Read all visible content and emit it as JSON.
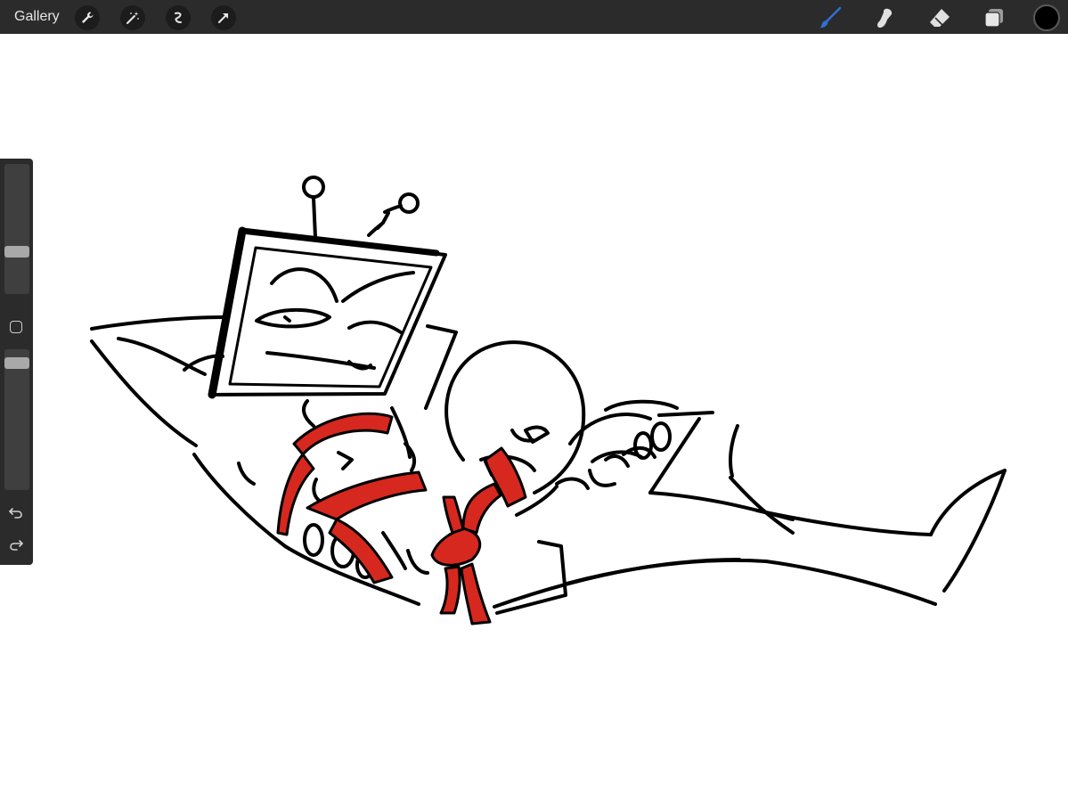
{
  "app": {
    "gallery_label": "Gallery"
  },
  "toolbar_left": {
    "icons": [
      "wrench-icon",
      "magic-wand-icon",
      "selection-icon",
      "transform-arrow-icon"
    ]
  },
  "toolbar_right": {
    "icons": [
      "brush-icon",
      "smudge-icon",
      "eraser-icon",
      "layers-icon"
    ],
    "active_tool": "brush",
    "active_tool_color": "#2f6fd6",
    "current_color": "#000000"
  },
  "sidebar": {
    "brush_size_level": 0.31,
    "opacity_level": 0.94,
    "undo_icon": "undo-icon",
    "redo_icon": "redo-icon"
  },
  "colors": {
    "toolbar_bg": "#2b2b2b",
    "canvas_bg": "#ffffff",
    "ribbon_red": "#d6281f",
    "ink": "#000000"
  }
}
